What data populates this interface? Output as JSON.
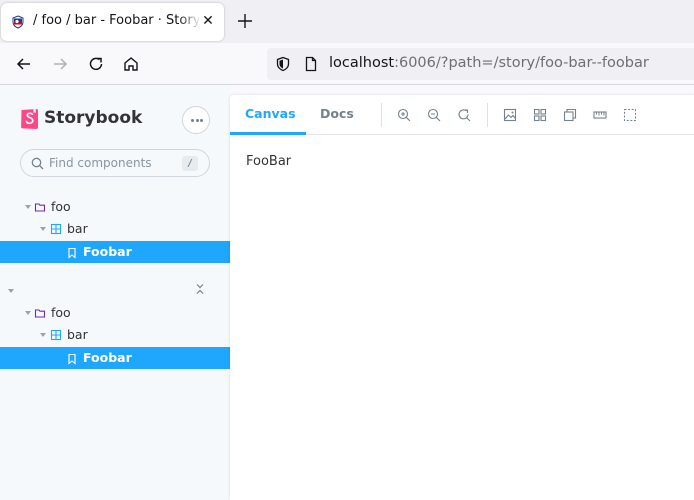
{
  "browser": {
    "tab_title": "/ foo / bar - Foobar · Storybook",
    "close_label": "✕",
    "url_host": "localhost",
    "url_path": ":6006/?path=/story/foo-bar--foobar"
  },
  "sidebar": {
    "brand": "Storybook",
    "search_placeholder": "Find components",
    "search_shortcut": "/",
    "tree1": [
      {
        "label": "foo"
      },
      {
        "label": "bar"
      },
      {
        "label": "Foobar"
      }
    ],
    "tree2": [
      {
        "label": "foo"
      },
      {
        "label": "bar"
      },
      {
        "label": "Foobar"
      }
    ]
  },
  "toolbar": {
    "tabs": [
      {
        "label": "Canvas"
      },
      {
        "label": "Docs"
      }
    ]
  },
  "canvas": {
    "content": "FooBar"
  },
  "colors": {
    "accent": "#1ea7fd",
    "storybook_pink": "#ff4785"
  }
}
